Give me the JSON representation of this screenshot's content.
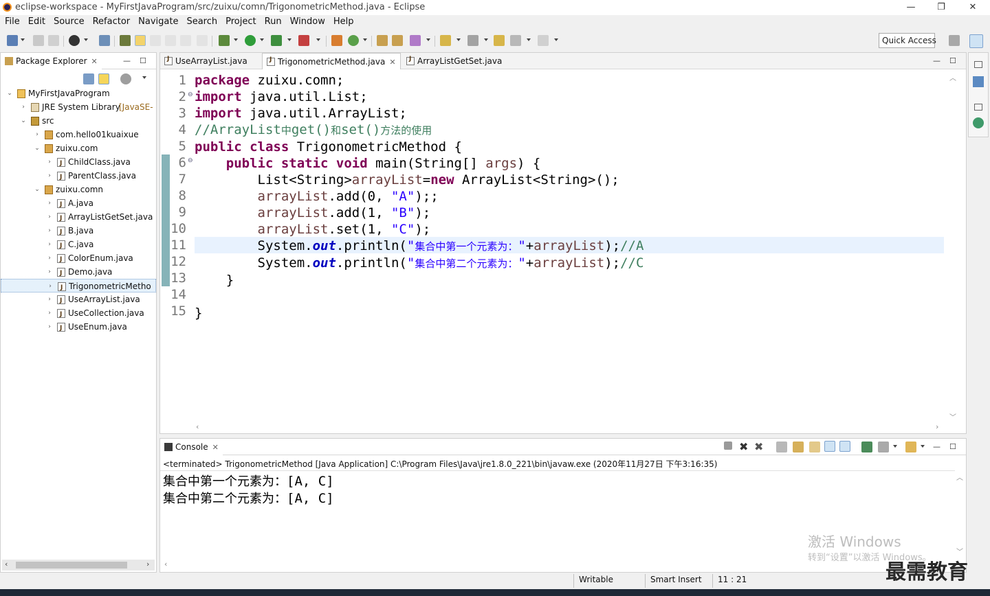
{
  "window": {
    "title": "eclipse-workspace - MyFirstJavaProgram/src/zuixu/comn/TrigonometricMethod.java - Eclipse",
    "minimize": "—",
    "maximize": "❐",
    "close": "✕"
  },
  "menu": [
    "File",
    "Edit",
    "Source",
    "Refactor",
    "Navigate",
    "Search",
    "Project",
    "Run",
    "Window",
    "Help"
  ],
  "toolbar": {
    "quick_access": "Quick Access"
  },
  "package_explorer": {
    "title": "Package Explorer",
    "tree": [
      {
        "label": "MyFirstJavaProgram",
        "arrow": "⌄",
        "icon": "project"
      },
      {
        "label": "JRE System Library",
        "suffix": "[JavaSE-",
        "arrow": "›",
        "icon": "library"
      },
      {
        "label": "src",
        "arrow": "⌄",
        "icon": "source-folder"
      },
      {
        "label": "com.hello01kuaixue",
        "arrow": "›",
        "icon": "package"
      },
      {
        "label": "zuixu.com",
        "arrow": "⌄",
        "icon": "package"
      },
      {
        "label": "ChildClass.java",
        "arrow": "›",
        "icon": "java-file"
      },
      {
        "label": "ParentClass.java",
        "arrow": "›",
        "icon": "java-file"
      },
      {
        "label": "zuixu.comn",
        "arrow": "⌄",
        "icon": "package"
      },
      {
        "label": "A.java",
        "arrow": "›",
        "icon": "java-file"
      },
      {
        "label": "ArrayListGetSet.java",
        "arrow": "›",
        "icon": "java-file"
      },
      {
        "label": "B.java",
        "arrow": "›",
        "icon": "java-file"
      },
      {
        "label": "C.java",
        "arrow": "›",
        "icon": "java-file"
      },
      {
        "label": "ColorEnum.java",
        "arrow": "›",
        "icon": "java-file"
      },
      {
        "label": "Demo.java",
        "arrow": "›",
        "icon": "java-file"
      },
      {
        "label": "TrigonometricMetho",
        "arrow": "›",
        "icon": "java-file"
      },
      {
        "label": "UseArrayList.java",
        "arrow": "›",
        "icon": "java-file"
      },
      {
        "label": "UseCollection.java",
        "arrow": "›",
        "icon": "java-file"
      },
      {
        "label": "UseEnum.java",
        "arrow": "›",
        "icon": "java-file"
      }
    ]
  },
  "editor": {
    "tabs": [
      "UseArrayList.java",
      "TrigonometricMethod.java",
      "ArrayListGetSet.java"
    ],
    "active_tab": 1,
    "line_numbers": [
      "1",
      "2",
      "3",
      "4",
      "5",
      "6",
      "7",
      "8",
      "9",
      "10",
      "11",
      "12",
      "13",
      "14",
      "15"
    ],
    "code": {
      "l1_kw": "package",
      "l1_rest": " zuixu.comn;",
      "l2_kw": "import",
      "l2_rest": " java.util.List;",
      "l3_kw": "import",
      "l3_rest": " java.util.ArrayList;",
      "l4_comment_a": "//ArrayList",
      "l4_comment_b": "中",
      "l4_comment_c": "get()",
      "l4_comment_d": "和",
      "l4_comment_e": "set()",
      "l4_comment_f": "方法的使用",
      "l5_kw": "public class",
      "l5_rest": " TrigonometricMethod {",
      "l6_kw": "public static void",
      "l6_rest_a": " main(String[] ",
      "l6_var": "args",
      "l6_rest_b": ") {",
      "l7_a": "List<String>",
      "l7_var": "arrayList",
      "l7_eq": "=",
      "l7_kw": "new",
      "l7_b": " ArrayList<String>();",
      "l8_var": "arrayList",
      "l8_a": ".add(0, ",
      "l8_str": "\"A\"",
      "l8_b": ");;",
      "l9_var": "arrayList",
      "l9_a": ".add(1, ",
      "l9_str": "\"B\"",
      "l9_b": ");",
      "l10_var": "arrayList",
      "l10_a": ".set(1, ",
      "l10_str": "\"C\"",
      "l10_b": ");",
      "l11_a": "System.",
      "l11_fld": "out",
      "l11_b": ".println(",
      "l11_str_a": "\"",
      "l11_str_cn": "集合中第一个元素为：",
      "l11_str_b": "\"",
      "l11_plus": "+",
      "l11_var": "arrayList",
      "l11_c": ");",
      "l11_cmt": "//A",
      "l12_a": "System.",
      "l12_fld": "out",
      "l12_b": ".println(",
      "l12_str_a": "\"",
      "l12_str_cn": "集合中第二个元素为：",
      "l12_str_b": "\"",
      "l12_plus": "+",
      "l12_var": "arrayList",
      "l12_c": ");",
      "l12_cmt": "//C",
      "l13": "}",
      "l15": "}"
    }
  },
  "console": {
    "title": "Console",
    "terminated": "<terminated> TrigonometricMethod [Java Application] C:\\Program Files\\Java\\jre1.8.0_221\\bin\\javaw.exe (2020年11月27日 下午3:16:35)",
    "line1_cn": "集合中第一个元素为：",
    "line1_val": "[A, C]",
    "line2_cn": "集合中第二个元素为：",
    "line2_val": "[A, C]"
  },
  "status": {
    "writable": "Writable",
    "insert_mode": "Smart Insert",
    "position": "11 : 21"
  },
  "watermark": {
    "activate": "激活 Windows",
    "activate_sub": "转到“设置”以激活 Windows。",
    "brand": "最需教育"
  },
  "colors": {
    "keyword": "#7f0055",
    "string": "#2a00ff",
    "comment": "#3f7f5f",
    "field": "#0000c0",
    "current_line": "#e8f2fe"
  }
}
